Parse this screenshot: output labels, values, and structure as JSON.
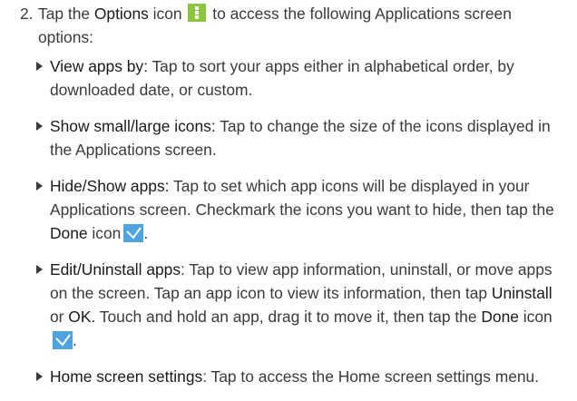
{
  "step": {
    "number": "2.",
    "text_before": "Tap the ",
    "options_term": "Options",
    "text_icon": " icon ",
    "text_after": " to access the following Applications screen",
    "text_cont": "options:"
  },
  "icons": {
    "options": "options-kebab-icon",
    "done": "done-checkmark-icon",
    "bullet": "triangle-bullet-icon",
    "options_color": "#8cc63f",
    "done_color": "#4fa3e0"
  },
  "bullets": [
    {
      "term": "View apps by:",
      "text": " Tap to sort your apps either in alphabetical order, by downloaded date, or custom."
    },
    {
      "term": "Show small/large icons:",
      "text": " Tap to change the size of the icons displayed in the Applications screen."
    },
    {
      "term": "Hide/Show apps:",
      "text": " Tap to set which app icons will be displayed in your Applications screen. Checkmark the icons you want to hide, then tap the ",
      "done_term": "Done",
      "done_text": " icon",
      "end": "."
    },
    {
      "term": "Edit/Uninstall apps",
      "text": ": Tap to view app information, uninstall, or move apps on the screen. Tap an app icon to view its information, then tap ",
      "uninstall_term": "Uninstall",
      "or_text": " or ",
      "ok_term": "OK",
      "text2": ". Touch and hold an app, drag it to move it, then tap the ",
      "done_term": "Done",
      "done_text": " icon",
      "end": "."
    },
    {
      "term": "Home screen settings",
      "text": ": Tap to access the Home screen settings menu."
    }
  ]
}
